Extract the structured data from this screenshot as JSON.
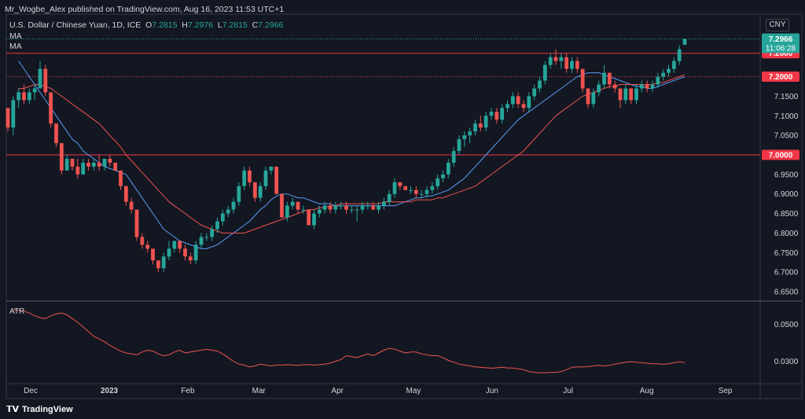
{
  "header": "Mr_Wogbe_Alex published on TradingView.com, Aug 16, 2023 11:53 UTC+1",
  "symbol_line": {
    "name": "U.S. Dollar / Chinese Yuan, 1D, ICE",
    "o_label": "O",
    "o": "7.2815",
    "h_label": "H",
    "h": "7.2976",
    "l_label": "L",
    "l": "7.2815",
    "c_label": "C",
    "c": "7.2966"
  },
  "ma_labels": [
    "MA",
    "MA"
  ],
  "currency": "CNY",
  "brand": "TradingView",
  "colors": {
    "background": "#131722",
    "up": "#26a69a",
    "down": "#ef5350",
    "ma_fast": "#5b9cf6",
    "ma_slow": "#ef5350",
    "atr": "#ef5350",
    "hline": "#f23645",
    "price_tag_up": "#26a69a"
  },
  "chart_data": [
    {
      "type": "candlestick",
      "title": "U.S. Dollar / Chinese Yuan, 1D, ICE",
      "ylim": [
        6.63,
        7.36
      ],
      "y_ticks": [
        "7.1500",
        "7.1000",
        "7.0500",
        "6.9500",
        "6.9000",
        "6.8500",
        "6.8000",
        "6.7500",
        "6.7000",
        "6.6500"
      ],
      "x_ticks": [
        "Dec",
        "2023",
        "Feb",
        "Mar",
        "Apr",
        "May",
        "Jun",
        "Jul",
        "Aug",
        "Sep"
      ],
      "x_tick_dates": [
        "2022-12-01",
        "2023-01-01",
        "2023-02-01",
        "2023-03-01",
        "2023-04-01",
        "2023-05-01",
        "2023-06-01",
        "2023-07-01",
        "2023-08-01",
        "2023-09-01"
      ],
      "horizontal_lines": [
        {
          "value": 7.26,
          "label": "7.2600",
          "style": "solid"
        },
        {
          "value": 7.2,
          "label": "7.2000",
          "style": "dotted"
        },
        {
          "value": 7.0,
          "label": "7.0000",
          "style": "solid"
        }
      ],
      "last_price": {
        "value": 7.2966,
        "label": "7.2966",
        "countdown": "11:06:28"
      },
      "candles": [
        [
          7.12,
          7.12,
          7.06,
          7.07
        ],
        [
          7.07,
          7.15,
          7.05,
          7.14
        ],
        [
          7.14,
          7.17,
          7.12,
          7.16
        ],
        [
          7.16,
          7.18,
          7.13,
          7.14
        ],
        [
          7.14,
          7.17,
          7.13,
          7.16
        ],
        [
          7.16,
          7.18,
          7.14,
          7.17
        ],
        [
          7.17,
          7.24,
          7.17,
          7.22
        ],
        [
          7.22,
          7.23,
          7.15,
          7.16
        ],
        [
          7.16,
          7.16,
          7.07,
          7.08
        ],
        [
          7.08,
          7.08,
          7.02,
          7.03
        ],
        [
          7.03,
          7.03,
          6.95,
          6.96
        ],
        [
          6.96,
          7.0,
          6.96,
          6.99
        ],
        [
          6.99,
          6.99,
          6.96,
          6.97
        ],
        [
          6.97,
          6.99,
          6.94,
          6.95
        ],
        [
          6.95,
          6.99,
          6.95,
          6.98
        ],
        [
          6.98,
          6.99,
          6.96,
          6.97
        ],
        [
          6.97,
          6.99,
          6.96,
          6.98
        ],
        [
          6.98,
          7.0,
          6.96,
          6.97
        ],
        [
          6.97,
          6.99,
          6.96,
          6.99
        ],
        [
          6.99,
          7.0,
          6.97,
          6.98
        ],
        [
          6.98,
          6.98,
          6.96,
          6.96
        ],
        [
          6.96,
          6.96,
          6.91,
          6.92
        ],
        [
          6.92,
          6.92,
          6.87,
          6.88
        ],
        [
          6.88,
          6.89,
          6.85,
          6.86
        ],
        [
          6.86,
          6.86,
          6.78,
          6.79
        ],
        [
          6.79,
          6.8,
          6.76,
          6.77
        ],
        [
          6.77,
          6.78,
          6.75,
          6.76
        ],
        [
          6.76,
          6.76,
          6.72,
          6.73
        ],
        [
          6.73,
          6.73,
          6.7,
          6.71
        ],
        [
          6.71,
          6.75,
          6.7,
          6.74
        ],
        [
          6.74,
          6.78,
          6.73,
          6.76
        ],
        [
          6.76,
          6.78,
          6.75,
          6.78
        ],
        [
          6.78,
          6.78,
          6.75,
          6.76
        ],
        [
          6.76,
          6.77,
          6.73,
          6.74
        ],
        [
          6.74,
          6.75,
          6.72,
          6.73
        ],
        [
          6.73,
          6.78,
          6.72,
          6.77
        ],
        [
          6.77,
          6.8,
          6.76,
          6.79
        ],
        [
          6.79,
          6.8,
          6.78,
          6.79
        ],
        [
          6.79,
          6.82,
          6.78,
          6.81
        ],
        [
          6.81,
          6.84,
          6.8,
          6.83
        ],
        [
          6.83,
          6.86,
          6.82,
          6.85
        ],
        [
          6.85,
          6.87,
          6.84,
          6.86
        ],
        [
          6.86,
          6.89,
          6.85,
          6.88
        ],
        [
          6.88,
          6.93,
          6.87,
          6.92
        ],
        [
          6.92,
          6.97,
          6.91,
          6.96
        ],
        [
          6.96,
          6.97,
          6.92,
          6.93
        ],
        [
          6.93,
          6.93,
          6.88,
          6.89
        ],
        [
          6.89,
          6.93,
          6.88,
          6.92
        ],
        [
          6.92,
          6.97,
          6.91,
          6.96
        ],
        [
          6.96,
          6.97,
          6.95,
          6.97
        ],
        [
          6.97,
          6.97,
          6.9,
          6.9
        ],
        [
          6.9,
          6.9,
          6.84,
          6.84
        ],
        [
          6.84,
          6.88,
          6.83,
          6.87
        ],
        [
          6.87,
          6.89,
          6.86,
          6.88
        ],
        [
          6.88,
          6.88,
          6.85,
          6.86
        ],
        [
          6.86,
          6.87,
          6.85,
          6.86
        ],
        [
          6.86,
          6.86,
          6.82,
          6.82
        ],
        [
          6.82,
          6.86,
          6.81,
          6.85
        ],
        [
          6.85,
          6.87,
          6.84,
          6.86
        ],
        [
          6.86,
          6.88,
          6.85,
          6.87
        ],
        [
          6.87,
          6.88,
          6.85,
          6.86
        ],
        [
          6.86,
          6.88,
          6.85,
          6.87
        ],
        [
          6.87,
          6.88,
          6.86,
          6.87
        ],
        [
          6.87,
          6.88,
          6.85,
          6.86
        ],
        [
          6.86,
          6.87,
          6.85,
          6.86
        ],
        [
          6.86,
          6.87,
          6.83,
          6.86
        ],
        [
          6.86,
          6.88,
          6.85,
          6.87
        ],
        [
          6.87,
          6.88,
          6.86,
          6.87
        ],
        [
          6.87,
          6.88,
          6.86,
          6.86
        ],
        [
          6.86,
          6.88,
          6.85,
          6.87
        ],
        [
          6.87,
          6.89,
          6.86,
          6.88
        ],
        [
          6.88,
          6.91,
          6.87,
          6.9
        ],
        [
          6.9,
          6.94,
          6.89,
          6.93
        ],
        [
          6.93,
          6.93,
          6.91,
          6.92
        ],
        [
          6.92,
          6.92,
          6.91,
          6.91
        ],
        [
          6.91,
          6.92,
          6.9,
          6.91
        ],
        [
          6.91,
          6.92,
          6.89,
          6.9
        ],
        [
          6.9,
          6.91,
          6.89,
          6.9
        ],
        [
          6.9,
          6.92,
          6.89,
          6.91
        ],
        [
          6.91,
          6.93,
          6.9,
          6.92
        ],
        [
          6.92,
          6.95,
          6.91,
          6.94
        ],
        [
          6.94,
          6.96,
          6.93,
          6.95
        ],
        [
          6.95,
          6.99,
          6.94,
          6.98
        ],
        [
          6.98,
          7.02,
          6.97,
          7.01
        ],
        [
          7.01,
          7.05,
          7.0,
          7.04
        ],
        [
          7.04,
          7.06,
          7.02,
          7.05
        ],
        [
          7.05,
          7.07,
          7.03,
          7.06
        ],
        [
          7.06,
          7.09,
          7.05,
          7.08
        ],
        [
          7.08,
          7.1,
          7.06,
          7.07
        ],
        [
          7.07,
          7.11,
          7.06,
          7.1
        ],
        [
          7.1,
          7.12,
          7.09,
          7.11
        ],
        [
          7.11,
          7.12,
          7.08,
          7.09
        ],
        [
          7.09,
          7.13,
          7.08,
          7.12
        ],
        [
          7.12,
          7.14,
          7.11,
          7.13
        ],
        [
          7.13,
          7.16,
          7.12,
          7.15
        ],
        [
          7.15,
          7.16,
          7.12,
          7.13
        ],
        [
          7.13,
          7.14,
          7.11,
          7.12
        ],
        [
          7.12,
          7.16,
          7.11,
          7.15
        ],
        [
          7.15,
          7.18,
          7.14,
          7.17
        ],
        [
          7.17,
          7.2,
          7.16,
          7.19
        ],
        [
          7.19,
          7.24,
          7.18,
          7.23
        ],
        [
          7.23,
          7.26,
          7.22,
          7.25
        ],
        [
          7.25,
          7.27,
          7.23,
          7.24
        ],
        [
          7.24,
          7.26,
          7.22,
          7.25
        ],
        [
          7.25,
          7.26,
          7.21,
          7.22
        ],
        [
          7.22,
          7.25,
          7.21,
          7.24
        ],
        [
          7.24,
          7.25,
          7.21,
          7.22
        ],
        [
          7.22,
          7.22,
          7.16,
          7.17
        ],
        [
          7.17,
          7.17,
          7.12,
          7.13
        ],
        [
          7.13,
          7.17,
          7.12,
          7.16
        ],
        [
          7.16,
          7.19,
          7.15,
          7.18
        ],
        [
          7.18,
          7.23,
          7.17,
          7.21
        ],
        [
          7.21,
          7.21,
          7.17,
          7.18
        ],
        [
          7.18,
          7.19,
          7.16,
          7.17
        ],
        [
          7.17,
          7.17,
          7.12,
          7.14
        ],
        [
          7.14,
          7.18,
          7.13,
          7.17
        ],
        [
          7.17,
          7.17,
          7.13,
          7.14
        ],
        [
          7.14,
          7.18,
          7.13,
          7.17
        ],
        [
          7.17,
          7.19,
          7.16,
          7.18
        ],
        [
          7.18,
          7.19,
          7.16,
          7.17
        ],
        [
          7.17,
          7.19,
          7.16,
          7.18
        ],
        [
          7.18,
          7.21,
          7.17,
          7.2
        ],
        [
          7.2,
          7.22,
          7.19,
          7.21
        ],
        [
          7.21,
          7.23,
          7.2,
          7.22
        ],
        [
          7.22,
          7.25,
          7.21,
          7.24
        ],
        [
          7.24,
          7.28,
          7.23,
          7.27
        ],
        [
          7.2815,
          7.2976,
          7.2815,
          7.2966
        ]
      ],
      "series": [
        {
          "type": "ma",
          "color": "blue",
          "values": [
            7.24,
            7.22,
            7.2,
            7.18,
            7.16,
            7.14,
            7.12,
            7.1,
            7.08,
            7.06,
            7.04,
            7.03,
            7.01,
            7.0,
            6.99,
            6.98,
            6.97,
            6.965,
            6.96,
            6.955,
            6.95,
            6.93,
            6.91,
            6.89,
            6.87,
            6.85,
            6.83,
            6.81,
            6.8,
            6.79,
            6.78,
            6.775,
            6.77,
            6.765,
            6.76,
            6.76,
            6.765,
            6.77,
            6.78,
            6.79,
            6.8,
            6.81,
            6.82,
            6.83,
            6.845,
            6.86,
            6.87,
            6.885,
            6.895,
            6.9,
            6.9,
            6.895,
            6.89,
            6.89,
            6.885,
            6.88,
            6.875,
            6.875,
            6.875,
            6.87,
            6.87,
            6.87,
            6.87,
            6.87,
            6.87,
            6.87,
            6.87,
            6.87,
            6.87,
            6.87,
            6.87,
            6.875,
            6.88,
            6.885,
            6.89,
            6.89,
            6.895,
            6.895,
            6.9,
            6.905,
            6.91,
            6.92,
            6.93,
            6.94,
            6.955,
            6.97,
            6.985,
            7.0,
            7.015,
            7.03,
            7.045,
            7.06,
            7.075,
            7.09,
            7.1,
            7.11,
            7.12,
            7.13,
            7.14,
            7.15,
            7.16,
            7.17,
            7.18,
            7.19,
            7.2,
            7.205,
            7.21,
            7.21,
            7.21,
            7.205,
            7.2,
            7.195,
            7.19,
            7.185,
            7.18,
            7.175,
            7.175,
            7.17,
            7.17,
            7.175,
            7.18,
            7.185,
            7.19,
            7.195,
            7.2
          ]
        },
        {
          "type": "ma",
          "color": "red",
          "values": [
            7.17,
            7.17,
            7.175,
            7.18,
            7.18,
            7.175,
            7.17,
            7.16,
            7.15,
            7.14,
            7.13,
            7.12,
            7.11,
            7.1,
            7.09,
            7.08,
            7.065,
            7.05,
            7.035,
            7.02,
            7.0,
            6.985,
            6.97,
            6.955,
            6.94,
            6.925,
            6.91,
            6.895,
            6.88,
            6.87,
            6.86,
            6.85,
            6.84,
            6.83,
            6.82,
            6.815,
            6.81,
            6.805,
            6.8,
            6.8,
            6.8,
            6.8,
            6.8,
            6.805,
            6.81,
            6.815,
            6.82,
            6.825,
            6.83,
            6.835,
            6.84,
            6.845,
            6.85,
            6.855,
            6.86,
            6.86,
            6.865,
            6.865,
            6.87,
            6.87,
            6.875,
            6.875,
            6.875,
            6.875,
            6.875,
            6.875,
            6.875,
            6.875,
            6.88,
            6.88,
            6.88,
            6.88,
            6.88,
            6.88,
            6.885,
            6.885,
            6.885,
            6.885,
            6.89,
            6.89,
            6.895,
            6.9,
            6.905,
            6.91,
            6.915,
            6.92,
            6.93,
            6.94,
            6.95,
            6.96,
            6.97,
            6.98,
            6.99,
            7.0,
            7.01,
            7.025,
            7.04,
            7.055,
            7.07,
            7.085,
            7.1,
            7.11,
            7.12,
            7.13,
            7.14,
            7.15,
            7.155,
            7.16,
            7.165,
            7.17,
            7.175,
            7.175,
            7.18,
            7.18,
            7.18,
            7.18,
            7.18,
            7.18,
            7.18,
            7.185,
            7.185,
            7.19,
            7.195,
            7.2,
            7.205
          ]
        }
      ]
    },
    {
      "type": "line",
      "title": "ATR",
      "ylim": [
        0.018,
        0.062
      ],
      "y_ticks": [
        "0.0500",
        "0.0300"
      ],
      "values": [
        0.0575,
        0.0575,
        0.057,
        0.056,
        0.0545,
        0.0535,
        0.053,
        0.0545,
        0.0555,
        0.056,
        0.055,
        0.053,
        0.051,
        0.0485,
        0.046,
        0.0435,
        0.042,
        0.0405,
        0.0385,
        0.037,
        0.0355,
        0.0345,
        0.034,
        0.0335,
        0.035,
        0.036,
        0.0355,
        0.034,
        0.033,
        0.0335,
        0.035,
        0.036,
        0.0345,
        0.035,
        0.0355,
        0.036,
        0.0365,
        0.036,
        0.0355,
        0.034,
        0.032,
        0.03,
        0.0285,
        0.028,
        0.027,
        0.0275,
        0.0285,
        0.028,
        0.0275,
        0.028,
        0.028,
        0.0282,
        0.028,
        0.0278,
        0.0282,
        0.0282,
        0.028,
        0.0282,
        0.0285,
        0.029,
        0.03,
        0.031,
        0.033,
        0.0325,
        0.032,
        0.033,
        0.034,
        0.033,
        0.0345,
        0.036,
        0.037,
        0.0365,
        0.0355,
        0.0345,
        0.035,
        0.035,
        0.034,
        0.0335,
        0.033,
        0.033,
        0.032,
        0.0305,
        0.0295,
        0.0285,
        0.028,
        0.0275,
        0.027,
        0.0268,
        0.0265,
        0.0263,
        0.0265,
        0.0268,
        0.0264,
        0.0264,
        0.026,
        0.0255,
        0.0245,
        0.024,
        0.0238,
        0.0238,
        0.024,
        0.024,
        0.0245,
        0.0255,
        0.0268,
        0.027,
        0.027,
        0.0272,
        0.0275,
        0.0278,
        0.0275,
        0.0278,
        0.0285,
        0.029,
        0.0295,
        0.0297,
        0.0295,
        0.0292,
        0.029,
        0.0287,
        0.0287,
        0.0285,
        0.0287,
        0.0292,
        0.0297,
        0.0293
      ]
    }
  ],
  "atr_label": "ATR",
  "atr_tick_values": [
    0.05,
    0.03
  ]
}
